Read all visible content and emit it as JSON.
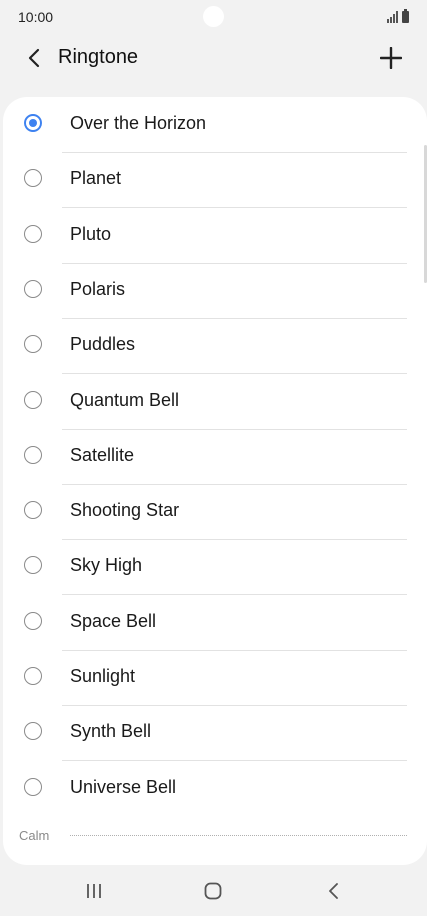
{
  "status_bar": {
    "time": "10:00",
    "icons": [
      "signal-icon",
      "battery-icon"
    ]
  },
  "header": {
    "title": "Ringtone",
    "back_icon": "chevron-left-icon",
    "add_icon": "plus-icon"
  },
  "ringtones": [
    {
      "label": "Over the Horizon",
      "selected": true
    },
    {
      "label": "Planet",
      "selected": false
    },
    {
      "label": "Pluto",
      "selected": false
    },
    {
      "label": "Polaris",
      "selected": false
    },
    {
      "label": "Puddles",
      "selected": false
    },
    {
      "label": "Quantum Bell",
      "selected": false
    },
    {
      "label": "Satellite",
      "selected": false
    },
    {
      "label": "Shooting Star",
      "selected": false
    },
    {
      "label": "Sky High",
      "selected": false
    },
    {
      "label": "Space Bell",
      "selected": false
    },
    {
      "label": "Sunlight",
      "selected": false
    },
    {
      "label": "Synth Bell",
      "selected": false
    },
    {
      "label": "Universe Bell",
      "selected": false
    }
  ],
  "section": {
    "label": "Calm"
  },
  "nav_bar": {
    "icons": [
      "recent-apps-icon",
      "home-icon",
      "back-icon"
    ]
  },
  "colors": {
    "accent": "#3e82f0",
    "background": "#f2f2f2",
    "card": "#ffffff"
  }
}
